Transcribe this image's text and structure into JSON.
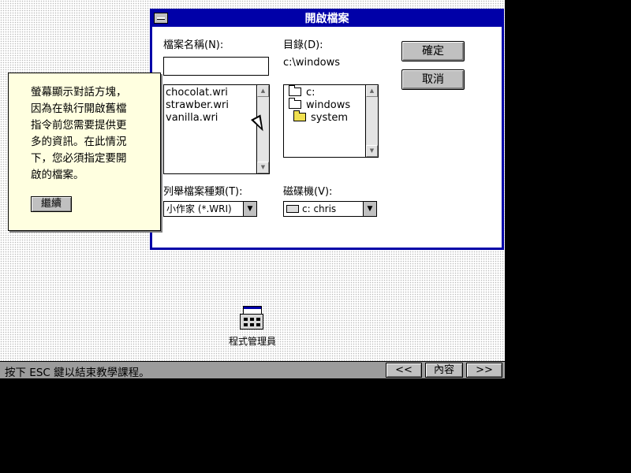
{
  "dialog": {
    "title": "開啟檔案",
    "filename_label": "檔案名稱(N):",
    "filename_value": "",
    "files": [
      "chocolat.wri",
      "strawber.wri",
      "vanilla.wri"
    ],
    "directory_label": "目錄(D):",
    "current_directory": "c:\\windows",
    "folders": [
      "c:",
      "windows",
      "system"
    ],
    "ok_label": "確定",
    "cancel_label": "取消",
    "file_type_label": "列舉檔案種類(T):",
    "file_type_value": "小作家 (*.WRI)",
    "drive_label": "磁碟機(V):",
    "drive_value": "c: chris"
  },
  "tutorial": {
    "message": "螢幕顯示對話方塊，\n因為在執行開啟舊檔\n指令前您需要提供更\n多的資訊。在此情況\n下，您必須指定要開\n啟的檔案。",
    "continue_label": "繼續"
  },
  "desktop": {
    "program_manager_label": "程式管理員"
  },
  "statusbar": {
    "text": "按下 ESC 鍵以結束教學課程。",
    "prev_label": "<<",
    "contents_label": "內容",
    "next_label": ">>"
  }
}
